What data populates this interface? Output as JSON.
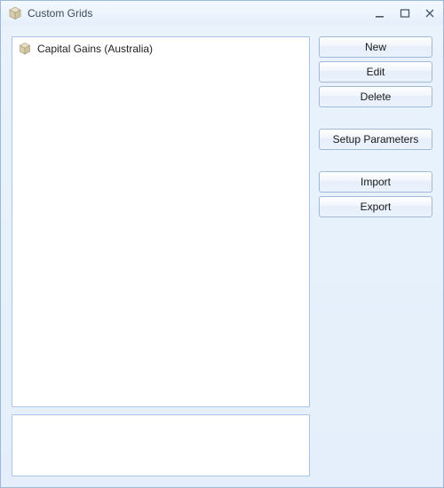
{
  "window": {
    "title": "Custom Grids"
  },
  "list": {
    "items": [
      {
        "label": "Capital Gains (Australia)"
      }
    ]
  },
  "buttons": {
    "new_label": "New",
    "edit_label": "Edit",
    "delete_label": "Delete",
    "setup_params_label": "Setup Parameters",
    "import_label": "Import",
    "export_label": "Export"
  }
}
